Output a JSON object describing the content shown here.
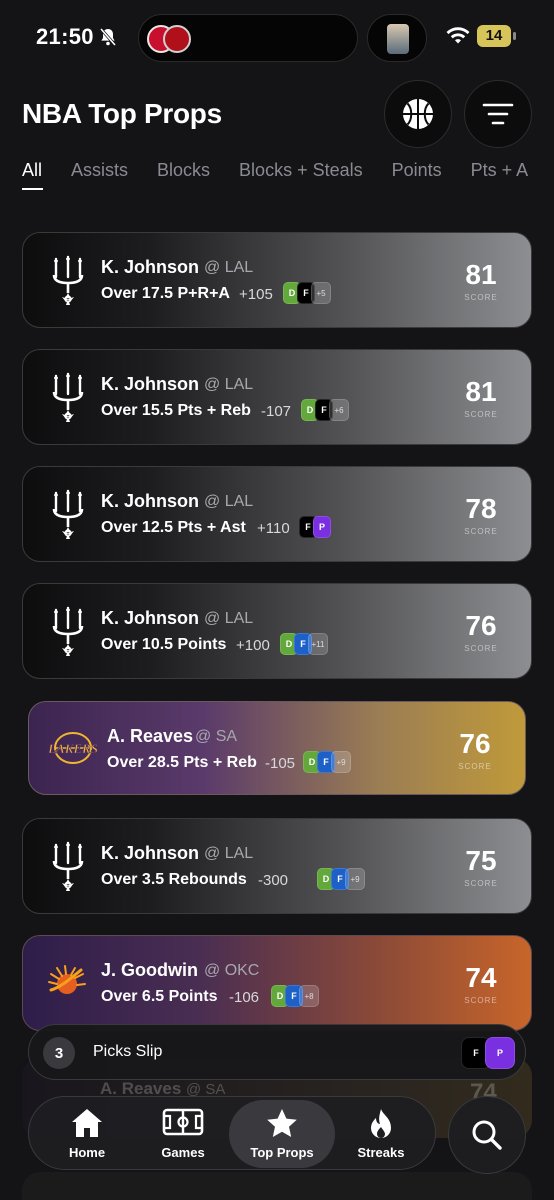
{
  "status_bar": {
    "time": "21:50",
    "battery": "14"
  },
  "header": {
    "title": "NBA Top Props"
  },
  "tabs": [
    "All",
    "Assists",
    "Blocks",
    "Blocks + Steals",
    "Points",
    "Pts + A"
  ],
  "cards": [
    {
      "player": "K. Johnson",
      "opponent": "@ LAL",
      "prop": "Over 17.5 P+R+A",
      "odds": "+105",
      "more": "+5",
      "score": "81",
      "score_label": "SCORE",
      "team": "spurs"
    },
    {
      "player": "K. Johnson",
      "opponent": "@ LAL",
      "prop": "Over 15.5 Pts + Reb",
      "odds": "-107",
      "more": "+6",
      "score": "81",
      "score_label": "SCORE",
      "team": "spurs"
    },
    {
      "player": "K. Johnson",
      "opponent": "@ LAL",
      "prop": "Over 12.5 Pts + Ast",
      "odds": "+110",
      "more": "",
      "score": "78",
      "score_label": "SCORE",
      "team": "spurs"
    },
    {
      "player": "K. Johnson",
      "opponent": "@ LAL",
      "prop": "Over 10.5 Points",
      "odds": "+100",
      "more": "+11",
      "score": "76",
      "score_label": "SCORE",
      "team": "spurs"
    },
    {
      "player": "A. Reaves",
      "opponent": "@ SA",
      "prop": "Over 28.5 Pts + Reb",
      "odds": "-105",
      "more": "+9",
      "score": "76",
      "score_label": "SCORE",
      "team": "lakers"
    },
    {
      "player": "K. Johnson",
      "opponent": "@ LAL",
      "prop": "Over 3.5 Rebounds",
      "odds": "-300",
      "more": "+9",
      "score": "75",
      "score_label": "SCORE",
      "team": "spurs"
    },
    {
      "player": "J. Goodwin",
      "opponent": "@ OKC",
      "prop": "Over 6.5 Points",
      "odds": "-106",
      "more": "+8",
      "score": "74",
      "score_label": "SCORE",
      "team": "suns"
    }
  ],
  "ghost_card": {
    "player": "A. Reaves",
    "opponent": "@ SA",
    "score": "74"
  },
  "picks_slip": {
    "count": "3",
    "label": "Picks Slip"
  },
  "nav": {
    "items": [
      {
        "label": "Home",
        "icon": "home-icon"
      },
      {
        "label": "Games",
        "icon": "court-icon"
      },
      {
        "label": "Top Props",
        "icon": "star-icon"
      },
      {
        "label": "Streaks",
        "icon": "flame-icon"
      }
    ],
    "search_icon": "search-icon"
  },
  "colors": {
    "background": "#141416",
    "draftkings": "#62a83a",
    "fanduel": "#1c60c8",
    "prizepicks": "#7a2fe0"
  }
}
